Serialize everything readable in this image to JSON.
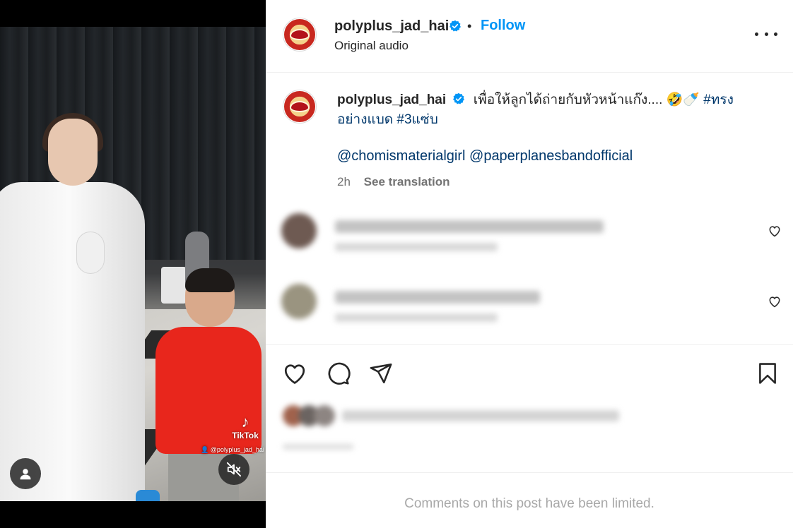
{
  "post": {
    "username": "polyplus_jad_hai",
    "follow_label": "Follow",
    "separator": "•",
    "audio_label": "Original audio"
  },
  "caption": {
    "username": "polyplus_jad_hai",
    "text": "เพื่อให้ลูกได้ถ่ายกับหัวหน้าแก๊ง....",
    "emoji": "🤣🍼",
    "hashtag1": "#ทรงอย่างแบด",
    "hashtag2": "#3แซ่บ",
    "mentions": "@chomismaterialgirl @paperplanesbandofficial",
    "time": "2h",
    "see_translation": "See translation"
  },
  "media": {
    "watermark_brand": "TikTok",
    "watermark_handle": "@polyplus_jad_hai"
  },
  "footer": {
    "limited_text": "Comments on this post have been limited."
  },
  "icons": {
    "verified": "verified-badge-icon",
    "more": "more-options-icon",
    "like": "heart-icon",
    "comment": "comment-icon",
    "share": "share-icon",
    "save": "bookmark-icon",
    "user": "user-icon",
    "mute": "muted-speaker-icon"
  },
  "colors": {
    "accent": "#0095f6",
    "link": "#00376b",
    "muted": "#737373"
  }
}
